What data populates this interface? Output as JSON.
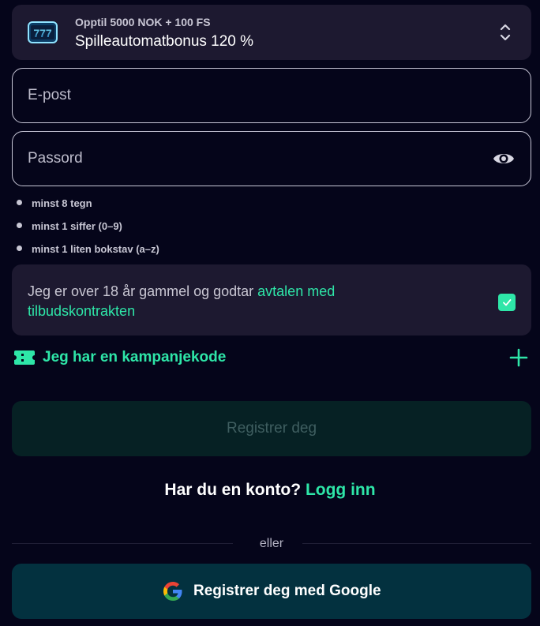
{
  "bonus": {
    "subtitle": "Opptil 5000 NOK + 100 FS",
    "title": "Spilleautomatbonus 120 %",
    "image_icon": "slot-777-icon",
    "chevron_icon": "chevron-up-down-icon"
  },
  "email": {
    "placeholder": "E-post",
    "value": ""
  },
  "password": {
    "placeholder": "Passord",
    "value": "",
    "toggle_icon": "eye-icon"
  },
  "password_rules": [
    "minst 8 tegn",
    "minst 1 siffer (0–9)",
    "minst 1 liten bokstav (a–z)"
  ],
  "terms": {
    "text": "Jeg er over 18 år gammel og godtar ",
    "link": "avtalen med tilbudskontrakten",
    "checked": true
  },
  "promo": {
    "label": "Jeg har en kampanjekode",
    "icon": "ticket-icon",
    "expand_icon": "plus-icon"
  },
  "submit": {
    "label": "Registrer deg"
  },
  "account": {
    "question": "Har du en konto?",
    "link": "Logg inn"
  },
  "divider": {
    "label": "eller"
  },
  "google": {
    "label": "Registrer deg med Google",
    "icon": "google-icon"
  },
  "colors": {
    "background": "#05051a",
    "card": "#1d1930",
    "accent": "#2ee6a8",
    "google_button": "#03313f",
    "disabled_button": "#062124"
  }
}
